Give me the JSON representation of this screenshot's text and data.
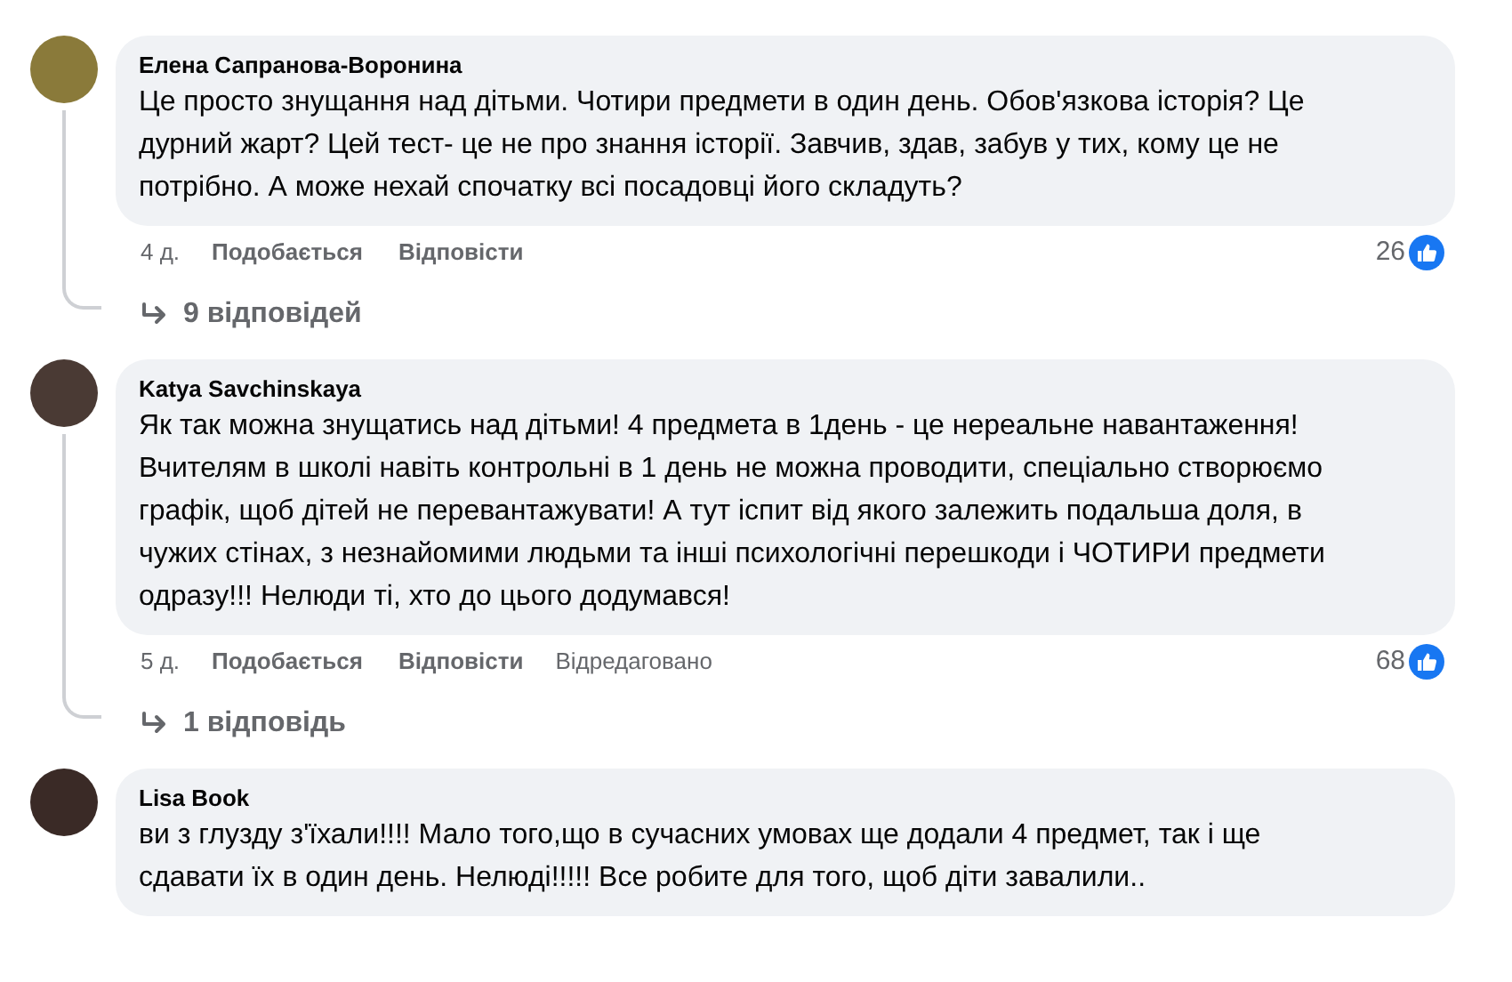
{
  "comments": [
    {
      "author": "Елена Сапранова-Воронина",
      "text": "Це просто знущання над дітьми. Чотири предмети в один день. Обов'язкова історія? Це дурний жарт? Цей тест- це не про знання історії. Завчив, здав, забув у тих, кому це не потрібно. А може нехай спочатку всі посадовці його складуть?",
      "time": "4 д.",
      "like": "Подобається",
      "reply": "Відповісти",
      "likes": "26",
      "replies": "9 відповідей"
    },
    {
      "author": "Katya Savchinskaya",
      "text": "Як так можна знущатись над дітьми! 4 предмета в 1день - це нереальне навантаження! Вчителям в школі навіть контрольні в 1 день не можна проводити, спеціально створюємо графік, щоб дітей не перевантажувати! А тут іспит від якого залежить подальша доля, в чужих стінах, з незнайомими людьми та інші психологічні перешкоди і ЧОТИРИ предмети одразу!!! Нелюди ті, хто до цього додумався!",
      "time": "5 д.",
      "like": "Подобається",
      "reply": "Відповісти",
      "edited": "Відредаговано",
      "likes": "68",
      "replies": "1 відповідь"
    },
    {
      "author": "Lisa Book",
      "text": "ви з глузду з'їхали!!!! Мало того,що в сучасних умовах ще додали 4 предмет, так і ще сдавати їх в один день. Нелюді!!!!! Все робите для того, щоб діти завалили.."
    }
  ]
}
